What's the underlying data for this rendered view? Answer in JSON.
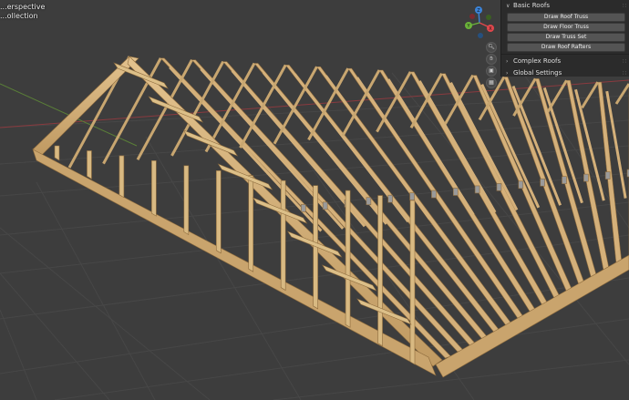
{
  "viewport": {
    "view_label": "...erspective",
    "collection_label": "...ollection"
  },
  "gizmo": {
    "z_label": "Z",
    "x_label": "X",
    "y_label": "Y",
    "neg_x_label": "",
    "colors": {
      "x": "#e0474c",
      "y": "#6bb33a",
      "z": "#3b84d9"
    }
  },
  "panel": {
    "basic_roofs": {
      "title": "Basic Roofs",
      "buttons": [
        "Draw Roof Truss",
        "Draw Floor Truss",
        "Draw Truss Set",
        "Draw Roof Rafters"
      ]
    },
    "complex_roofs": {
      "title": "Complex Roofs"
    },
    "global_settings": {
      "title": "Global Settings"
    }
  },
  "colors": {
    "background": "#3d3d3d",
    "grid": "#4a4a4a",
    "wood": "#d4b07a",
    "wood_dark": "#a98553",
    "plate": "#9a9a9a"
  }
}
